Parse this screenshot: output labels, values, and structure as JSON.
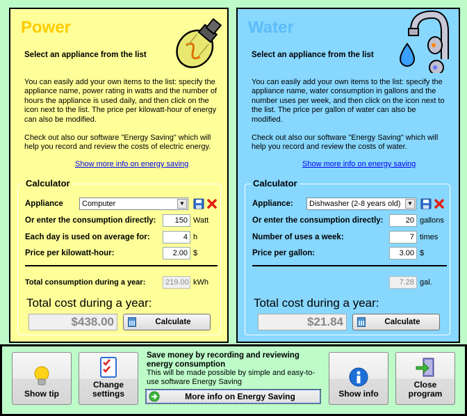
{
  "power": {
    "title": "Power",
    "subtitle": "Select an appliance from the list",
    "description": [
      "You can easily add your own items to the list: specify the appliance name, power rating in watts and the number of hours the appliance is used daily, and then click on the icon next to the list. The price per kilowatt-hour of energy can also be modified.",
      "Check out also our software \"Energy Saving\" which will help you record and review the costs of electric energy."
    ],
    "link": "Show more info on energy saving",
    "calculator": {
      "legend": "Calculator",
      "appliance_label": "Appliance",
      "appliance_value": "Computer",
      "consumption_label": "Or enter the consumption directly:",
      "consumption_value": "150",
      "consumption_unit": "Watt",
      "usage_label": "Each day is used on average for:",
      "usage_value": "4",
      "usage_unit": "h",
      "price_label": "Price per kilowatt-hour:",
      "price_value": "2.00",
      "price_unit": "$",
      "total_consumption_label": "Total consumption during a year:",
      "total_consumption_value": "219.00",
      "total_consumption_unit": "kWh",
      "total_cost_label": "Total cost during a year:",
      "total_cost_value": "$438.00",
      "calculate_label": "Calculate"
    }
  },
  "water": {
    "title": "Water",
    "subtitle": "Select an appliance from the list",
    "description": [
      "You can easily add your own items to the list: specify the appliance name, water consumption in gallons and the number uses per week, and then click on the icon next to the list. The price per gallon of water can also be modified.",
      "Check out also our software \"Energy Saving\" which will help you record and review the costs of water."
    ],
    "link": "Show more info on energy saving",
    "calculator": {
      "legend": "Calculator",
      "appliance_label": "Appliance:",
      "appliance_value": "Dishwasher (2-8 years old)",
      "consumption_label": "Or enter the consumption directly:",
      "consumption_value": "20",
      "consumption_unit": "gallons",
      "usage_label": "Number of uses a week:",
      "usage_value": "7",
      "usage_unit": "times",
      "price_label": "Price per gallon:",
      "price_value": "3.00",
      "price_unit": "$",
      "total_consumption_value": "7.28",
      "total_consumption_unit": "gal.",
      "total_cost_label": "Total cost during a year:",
      "total_cost_value": "$21.84",
      "calculate_label": "Calculate"
    }
  },
  "footer": {
    "show_tip": "Show tip",
    "change_settings": "Change settings",
    "promo_title": "Save money by recording and reviewing energy consumption",
    "promo_desc": "This will be made possible by simple and easy-to-use software Energy Saving",
    "more_info": "More info on Energy Saving",
    "show_info": "Show info",
    "close_program": "Close program"
  },
  "icons": {
    "power_art": "light-bulb",
    "water_art": "faucet-with-drop",
    "save": "floppy-disk",
    "delete": "red-x",
    "calculate": "calculator",
    "show_tip": "light-bulb",
    "change_settings": "checklist",
    "more_info": "green-arrow",
    "show_info": "info-circle",
    "close_program": "exit-door"
  }
}
